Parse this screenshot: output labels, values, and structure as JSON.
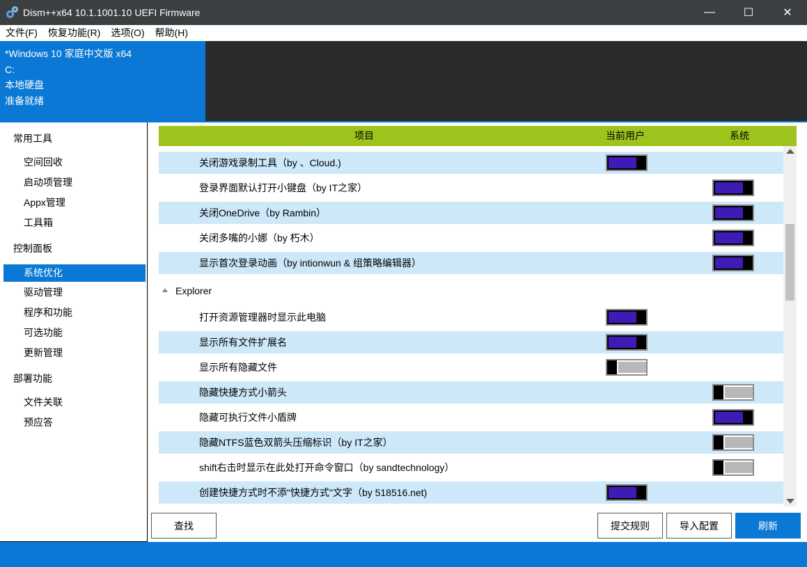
{
  "window": {
    "title": "Dism++x64 10.1.1001.10 UEFI Firmware",
    "minimize": "—",
    "maximize": "☐",
    "close": "✕"
  },
  "menu": [
    "文件(F)",
    "恢复功能(R)",
    "选项(O)",
    "帮助(H)"
  ],
  "session": {
    "os": "*Windows 10 家庭中文版 x64",
    "drive": "C:",
    "disk_type": "本地硬盘",
    "status": "准备就绪"
  },
  "sidebar": {
    "groups": [
      {
        "label": "常用工具",
        "items": [
          "空间回收",
          "启动项管理",
          "Appx管理",
          "工具箱"
        ]
      },
      {
        "label": "控制面板",
        "items": [
          "系统优化",
          "驱动管理",
          "程序和功能",
          "可选功能",
          "更新管理"
        ]
      },
      {
        "label": "部署功能",
        "items": [
          "文件关联",
          "预应答"
        ]
      }
    ],
    "active": "系统优化"
  },
  "table": {
    "headers": {
      "item": "项目",
      "user": "当前用户",
      "system": "系统"
    },
    "rows": [
      {
        "label": "关闭游戏录制工具（by 、Cloud.)",
        "user": true,
        "system": null
      },
      {
        "label": "登录界面默认打开小键盘（by IT之家）",
        "user": null,
        "system": true
      },
      {
        "label": "关闭OneDrive（by Rambin）",
        "user": null,
        "system": true
      },
      {
        "label": "关闭多嘴的小娜（by 朽木）",
        "user": null,
        "system": true
      },
      {
        "label": "显示首次登录动画（by intionwun & 组策略编辑器）",
        "user": null,
        "system": true
      }
    ],
    "group": "Explorer",
    "group_rows": [
      {
        "label": "打开资源管理器时显示此电脑",
        "user": true,
        "system": null
      },
      {
        "label": "显示所有文件扩展名",
        "user": true,
        "system": null
      },
      {
        "label": "显示所有隐藏文件",
        "user": false,
        "system": null
      },
      {
        "label": "隐藏快捷方式小箭头",
        "user": null,
        "system": false
      },
      {
        "label": "隐藏可执行文件小盾牌",
        "user": null,
        "system": true
      },
      {
        "label": "隐藏NTFS蓝色双箭头压缩标识（by IT之家）",
        "user": null,
        "system": false
      },
      {
        "label": "shift右击时显示在此处打开命令窗口（by sandtechnology）",
        "user": null,
        "system": false
      },
      {
        "label": "创建快捷方式时不添\"快捷方式\"文字（by 518516.net)",
        "user": true,
        "system": null
      }
    ]
  },
  "buttons": {
    "find": "查找",
    "submit_rule": "提交规则",
    "import_config": "导入配置",
    "refresh": "刷新"
  },
  "colors": {
    "accent": "#0a78d4",
    "header_green": "#9dc41c",
    "row_shade": "#cce8f9",
    "toggle_on": "#3e1bb4"
  }
}
